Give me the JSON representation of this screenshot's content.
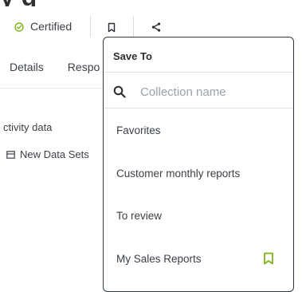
{
  "page": {
    "title_fragment": "y   g"
  },
  "toolbar": {
    "certified_label": "Certified",
    "check_icon": "check-circle-icon",
    "bookmark_icon": "bookmark-icon",
    "share_icon": "share-icon",
    "accent_color": "#7cb518"
  },
  "tabs": [
    {
      "label": "Details"
    },
    {
      "label": "Respo"
    }
  ],
  "content": {
    "activity_label": "ctivity data",
    "new_data_sets_label": "New Data Sets"
  },
  "save_to": {
    "title": "Save To",
    "search": {
      "placeholder": "Collection name",
      "value": ""
    },
    "collections": [
      {
        "label": "Favorites",
        "saved": false
      },
      {
        "label": "Customer monthly reports",
        "saved": false
      },
      {
        "label": "To review",
        "saved": false
      },
      {
        "label": "My Sales Reports",
        "saved": true
      }
    ]
  }
}
